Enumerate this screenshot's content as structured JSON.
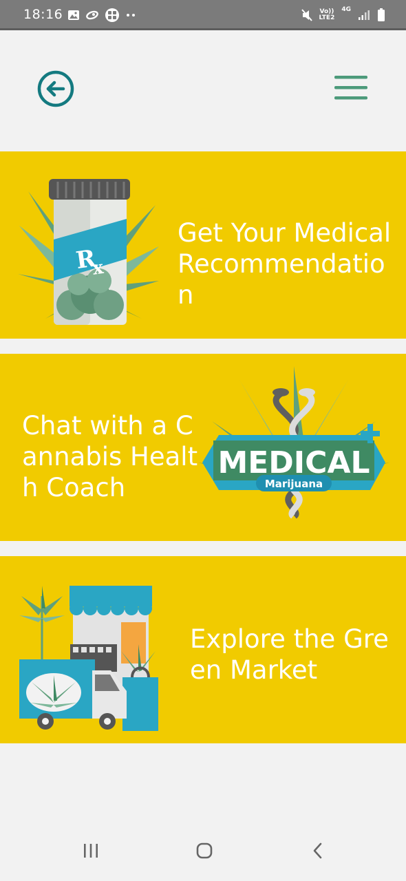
{
  "status_bar": {
    "time": "18:16",
    "left_icons": [
      "image-icon",
      "link-icon",
      "app-grid-icon",
      "more-dots-icon"
    ],
    "volte_top": "Vo))",
    "volte_bottom": "LTE2",
    "network_type": "4G",
    "right_icons": [
      "mute-icon",
      "signal-icon",
      "battery-icon"
    ]
  },
  "header": {
    "back_icon": "arrow-left-circle-icon",
    "menu_icon": "hamburger-menu-icon",
    "accent_color": "#147a80",
    "menu_color": "#4c9a7a"
  },
  "cards": [
    {
      "title": "Get Your Medical Recommendation",
      "art": "rx-pill-bottle-illustration"
    },
    {
      "title": "Chat with a Cannabis Health Coach",
      "art": "medical-marijuana-emblem",
      "emblem_text": "MEDICAL",
      "emblem_subtext": "Marijuana"
    },
    {
      "title": "Explore the Green Market",
      "art": "market-truck-illustration"
    }
  ],
  "colors": {
    "card_background": "#f1cb00",
    "page_background": "#f2f2f2",
    "title_text": "#ffffff"
  },
  "nav_bar": {
    "icons": [
      "recent-apps-icon",
      "home-icon",
      "back-chevron-icon"
    ]
  }
}
